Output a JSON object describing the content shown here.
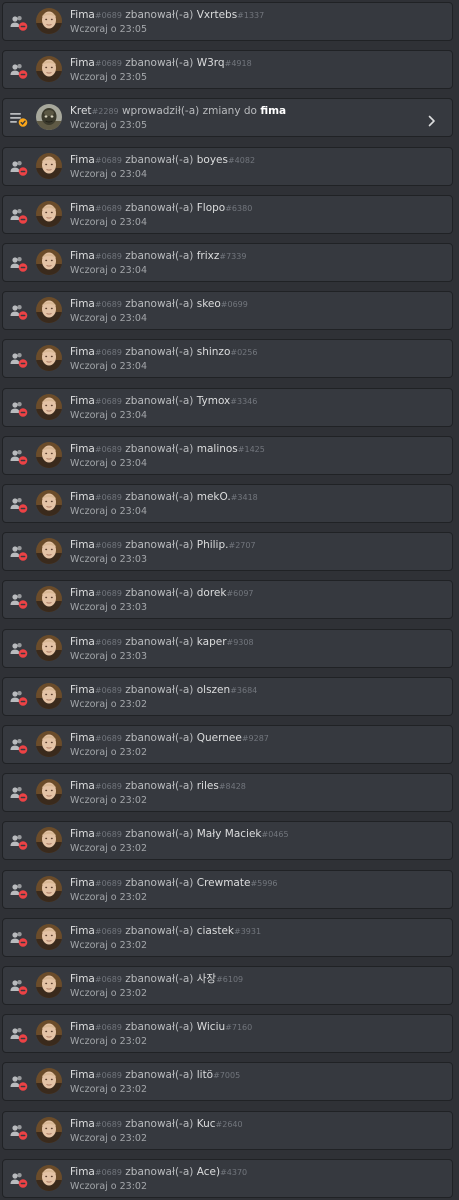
{
  "colors": {
    "background": "#2f3136",
    "card": "#36393f",
    "ban_icon_red": "#ed4245",
    "icon_gray": "#b9bbbe",
    "update_icon_yellow": "#faa61a"
  },
  "entries": [
    {
      "type": "ban",
      "actor": "Fima",
      "actor_disc": "#0689",
      "action": "zbanował(-a)",
      "target": "Vxrtebs",
      "target_disc": "#1337",
      "time": "Wczoraj o 23:05"
    },
    {
      "type": "ban",
      "actor": "Fima",
      "actor_disc": "#0689",
      "action": "zbanował(-a)",
      "target": "W3rq",
      "target_disc": "#4918",
      "time": "Wczoraj o 23:05"
    },
    {
      "type": "update",
      "actor": "Kret",
      "actor_disc": "#2289",
      "action": "wprowadził(-a) zmiany do",
      "target": "fima",
      "target_disc": "",
      "time": "Wczoraj o 23:05",
      "expandable": true
    },
    {
      "type": "ban",
      "actor": "Fima",
      "actor_disc": "#0689",
      "action": "zbanował(-a)",
      "target": "boyes",
      "target_disc": "#4082",
      "time": "Wczoraj o 23:04"
    },
    {
      "type": "ban",
      "actor": "Fima",
      "actor_disc": "#0689",
      "action": "zbanował(-a)",
      "target": "Flopo",
      "target_disc": "#6380",
      "time": "Wczoraj o 23:04"
    },
    {
      "type": "ban",
      "actor": "Fima",
      "actor_disc": "#0689",
      "action": "zbanował(-a)",
      "target": "frixz",
      "target_disc": "#7339",
      "time": "Wczoraj o 23:04"
    },
    {
      "type": "ban",
      "actor": "Fima",
      "actor_disc": "#0689",
      "action": "zbanował(-a)",
      "target": "skeo",
      "target_disc": "#0699",
      "time": "Wczoraj o 23:04"
    },
    {
      "type": "ban",
      "actor": "Fima",
      "actor_disc": "#0689",
      "action": "zbanował(-a)",
      "target": "shinzo",
      "target_disc": "#0256",
      "time": "Wczoraj o 23:04"
    },
    {
      "type": "ban",
      "actor": "Fima",
      "actor_disc": "#0689",
      "action": "zbanował(-a)",
      "target": "Tymox",
      "target_disc": "#3346",
      "time": "Wczoraj o 23:04"
    },
    {
      "type": "ban",
      "actor": "Fima",
      "actor_disc": "#0689",
      "action": "zbanował(-a)",
      "target": "malinos",
      "target_disc": "#1425",
      "time": "Wczoraj o 23:04"
    },
    {
      "type": "ban",
      "actor": "Fima",
      "actor_disc": "#0689",
      "action": "zbanował(-a)",
      "target": "mekO.",
      "target_disc": "#3418",
      "time": "Wczoraj o 23:04"
    },
    {
      "type": "ban",
      "actor": "Fima",
      "actor_disc": "#0689",
      "action": "zbanował(-a)",
      "target": "Philip.",
      "target_disc": "#2707",
      "time": "Wczoraj o 23:03"
    },
    {
      "type": "ban",
      "actor": "Fima",
      "actor_disc": "#0689",
      "action": "zbanował(-a)",
      "target": "dorek",
      "target_disc": "#6097",
      "time": "Wczoraj o 23:03"
    },
    {
      "type": "ban",
      "actor": "Fima",
      "actor_disc": "#0689",
      "action": "zbanował(-a)",
      "target": "kaper",
      "target_disc": "#9308",
      "time": "Wczoraj o 23:03"
    },
    {
      "type": "ban",
      "actor": "Fima",
      "actor_disc": "#0689",
      "action": "zbanował(-a)",
      "target": "olszen",
      "target_disc": "#3684",
      "time": "Wczoraj o 23:02"
    },
    {
      "type": "ban",
      "actor": "Fima",
      "actor_disc": "#0689",
      "action": "zbanował(-a)",
      "target": "Quernee",
      "target_disc": "#9287",
      "time": "Wczoraj o 23:02"
    },
    {
      "type": "ban",
      "actor": "Fima",
      "actor_disc": "#0689",
      "action": "zbanował(-a)",
      "target": "riles",
      "target_disc": "#8428",
      "time": "Wczoraj o 23:02"
    },
    {
      "type": "ban",
      "actor": "Fima",
      "actor_disc": "#0689",
      "action": "zbanował(-a)",
      "target": "Mały Maciek",
      "target_disc": "#0465",
      "time": "Wczoraj o 23:02"
    },
    {
      "type": "ban",
      "actor": "Fima",
      "actor_disc": "#0689",
      "action": "zbanował(-a)",
      "target": "Crewmate",
      "target_disc": "#5996",
      "time": "Wczoraj o 23:02"
    },
    {
      "type": "ban",
      "actor": "Fima",
      "actor_disc": "#0689",
      "action": "zbanował(-a)",
      "target": "ciastek",
      "target_disc": "#3931",
      "time": "Wczoraj o 23:02"
    },
    {
      "type": "ban",
      "actor": "Fima",
      "actor_disc": "#0689",
      "action": "zbanował(-a)",
      "target": "사장",
      "target_disc": "#6109",
      "time": "Wczoraj o 23:02"
    },
    {
      "type": "ban",
      "actor": "Fima",
      "actor_disc": "#0689",
      "action": "zbanował(-a)",
      "target": "Wiciu",
      "target_disc": "#7160",
      "time": "Wczoraj o 23:02"
    },
    {
      "type": "ban",
      "actor": "Fima",
      "actor_disc": "#0689",
      "action": "zbanował(-a)",
      "target": "litö",
      "target_disc": "#7005",
      "time": "Wczoraj o 23:02"
    },
    {
      "type": "ban",
      "actor": "Fima",
      "actor_disc": "#0689",
      "action": "zbanował(-a)",
      "target": "Kuc",
      "target_disc": "#2640",
      "time": "Wczoraj o 23:02"
    },
    {
      "type": "ban",
      "actor": "Fima",
      "actor_disc": "#0689",
      "action": "zbanował(-a)",
      "target": "Ace)",
      "target_disc": "#4370",
      "time": "Wczoraj o 23:02"
    }
  ]
}
